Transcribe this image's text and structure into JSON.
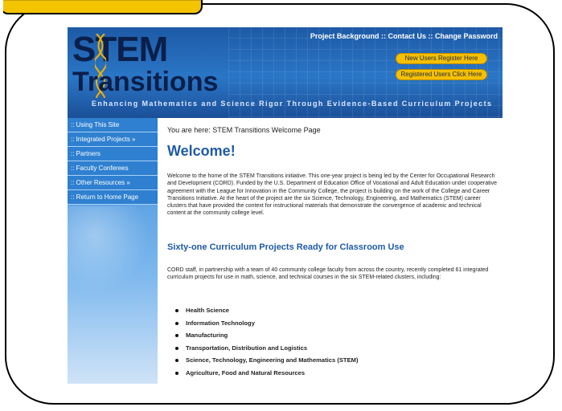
{
  "site": {
    "logo_line1": "STEM",
    "logo_line2": "Transitions",
    "tagline": "Enhancing Mathematics and Science Rigor Through Evidence-Based Curriculum Projects",
    "top_links": [
      "Project Background",
      "Contact Us",
      "Change Password"
    ],
    "top_link_separator": " :: ",
    "buttons": {
      "register": "New Users Register Here",
      "login": "Registered Users Click Here"
    }
  },
  "sidebar": {
    "items": [
      {
        "label": ":: Using This Site"
      },
      {
        "label": ":: Integrated Projects »"
      },
      {
        "label": ":: Partners"
      },
      {
        "label": ":: Faculty Conferees"
      },
      {
        "label": ":: Other Resources »"
      },
      {
        "label": ":: Return to Home Page"
      }
    ]
  },
  "main": {
    "breadcrumb": "You are here: STEM Transitions Welcome Page",
    "title": "Welcome!",
    "intro": "Welcome to the home of the STEM Transitions initiative. This one-year project is being led by the Center for Occupational Research and Development (CORD). Funded by the U.S. Department of Education Office of Vocational and Adult Education under cooperative agreement with the League for Innovation in the Community College, the project is building on the work of the College and Career Transitions Initiative. At the heart of the project are the six Science, Technology, Engineering, and Mathematics (STEM) career clusters that have provided the context for instructional materials that demonstrate the convergence of academic and technical content at the community college level.",
    "subtitle": "Sixty-one Curriculum Projects Ready for Classroom Use",
    "body": "CORD staff, in partnership with a team of 40 community college faculty from across the country, recently completed 61 integrated curriculum projects for use in math, science, and technical courses in the six STEM-related clusters, including:",
    "clusters": [
      "Health Science",
      "Information Technology",
      "Manufacturing",
      "Transportation, Distribution and Logistics",
      "Science, Technology, Engineering and Mathematics (STEM)",
      "Agriculture, Food and Natural Resources"
    ]
  },
  "colors": {
    "accent": "#1f5aa6",
    "header_bg": "#2a76c6",
    "button": "#f6c000",
    "tab_highlight": "#f5c400"
  }
}
